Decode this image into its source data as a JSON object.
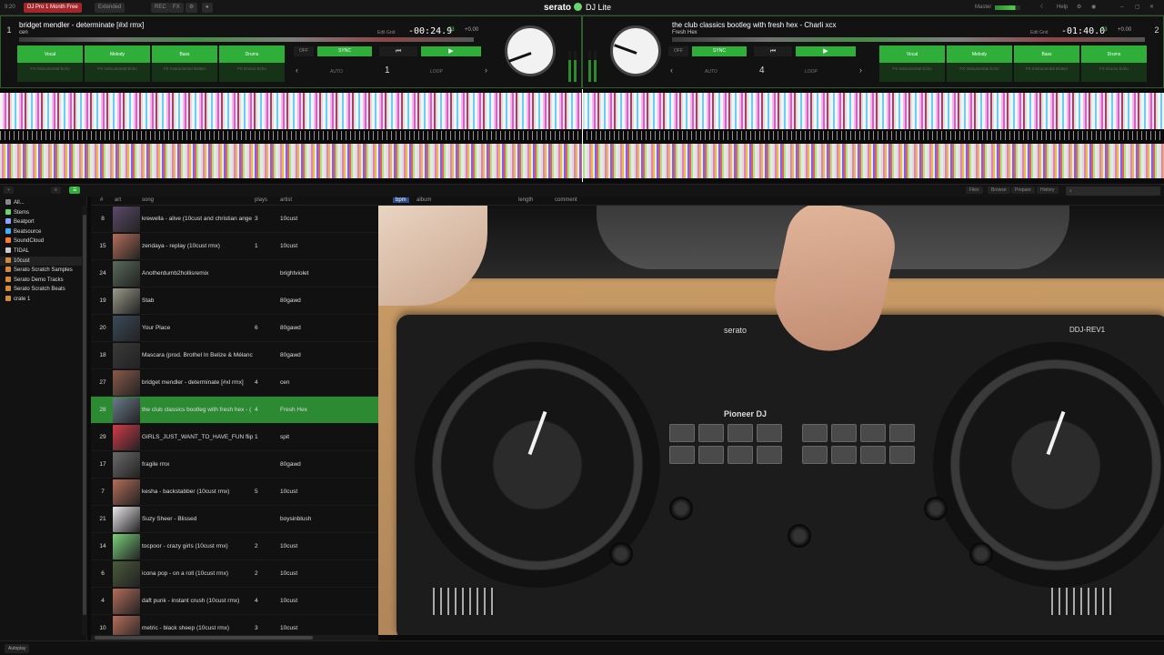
{
  "app": {
    "clock": "9:20",
    "promo": "DJ Pro 1 Month Free",
    "extended": "Extended",
    "rec": "REC",
    "fx": "FX",
    "logo": "serato",
    "logo_sub": "DJ Lite",
    "master": "Master",
    "help": "Help"
  },
  "deck1": {
    "number": "1",
    "title": "bridget mendler - determinate [#xl rmx]",
    "artist": "cen",
    "edit_grid": "Edit Grid",
    "time": "-00:24.9",
    "bpm": "73",
    "pitch": "+0.00",
    "stems": [
      {
        "label": "Vocal",
        "sub": "FX\nInstrumental\nEcho"
      },
      {
        "label": "Melody",
        "sub": "FX\nInstrumental\nEcho"
      },
      {
        "label": "Bass",
        "sub": "FX\nInstrumental\nBraker"
      },
      {
        "label": "Drums",
        "sub": "FX\nDrums\nEcho"
      }
    ],
    "sync_off": "OFF",
    "sync": "SYNC",
    "auto": "AUTO",
    "loop_value": "1",
    "loop": "LOOP"
  },
  "deck2": {
    "number": "2",
    "title": "the club classics bootleg with fresh hex - Charli xcx",
    "artist": "Fresh Hex",
    "edit_grid": "Edit Grid",
    "time": "-01:40.0",
    "bpm": "73",
    "pitch": "+0.00",
    "stems": [
      {
        "label": "Vocal",
        "sub": "FX\nInstrumental\nEcho"
      },
      {
        "label": "Melody",
        "sub": "FX\nInstrumental\nEcho"
      },
      {
        "label": "Bass",
        "sub": "FX\nInstrumental\nBraker"
      },
      {
        "label": "Drums",
        "sub": "FX\nDrums\nEcho"
      }
    ],
    "sync_off": "OFF",
    "sync": "SYNC",
    "auto": "AUTO",
    "loop_value": "4",
    "loop": "LOOP"
  },
  "library_bar": {
    "files": "Files",
    "browse": "Browse",
    "prepare": "Prepare",
    "history": "History",
    "search_placeholder": ""
  },
  "sidebar": {
    "items": [
      {
        "label": "All...",
        "color": "#888888"
      },
      {
        "label": "Stems",
        "color": "#6dd36d"
      },
      {
        "label": "Beatport",
        "color": "#8aa4ff"
      },
      {
        "label": "Beatsource",
        "color": "#39b3ff"
      },
      {
        "label": "SoundCloud",
        "color": "#ff7a2b"
      },
      {
        "label": "TIDAL",
        "color": "#cccccc"
      },
      {
        "label": "10cust",
        "color": "#d48a3a"
      },
      {
        "label": "Serato Scratch Samples",
        "color": "#d48a3a"
      },
      {
        "label": "Serato Demo Tracks",
        "color": "#d48a3a"
      },
      {
        "label": "Serato Scratch Beats",
        "color": "#d48a3a"
      },
      {
        "label": "crate 1",
        "color": "#d48a3a"
      }
    ]
  },
  "columns": {
    "num": "#",
    "art": "art",
    "song": "song",
    "plays": "plays",
    "artist": "artist",
    "bpm": "bpm",
    "album": "album",
    "length": "length",
    "comment": "comment"
  },
  "tracks": [
    {
      "num": "8",
      "song": "krewella - alive (10cust and christian ange",
      "plays": "3",
      "artist": "10cust",
      "art": "#5c4a6a"
    },
    {
      "num": "15",
      "song": "zendaya - replay (10cust rmx)",
      "plays": "1",
      "artist": "10cust",
      "art": "#b46d5a"
    },
    {
      "num": "24",
      "song": "Anotherdumb2hollisremix",
      "plays": "",
      "artist": "brightviolet",
      "art": "#5a6a5a"
    },
    {
      "num": "19",
      "song": "Stab",
      "plays": "",
      "artist": "80gawd",
      "art": "#9a9a8a"
    },
    {
      "num": "20",
      "song": "Your Place",
      "plays": "6",
      "artist": "80gawd",
      "art": "#3a4a5a"
    },
    {
      "num": "18",
      "song": "Mascara (prod. Brothel In Belize & Mélanc",
      "plays": "",
      "artist": "80gawd",
      "art": "#3a3a3a"
    },
    {
      "num": "27",
      "song": "bridget mendler - determinate [#xl rmx]",
      "plays": "4",
      "artist": "cen",
      "art": "#8a5a4a"
    },
    {
      "num": "28",
      "song": "the club classics bootleg with fresh hex - ( ",
      "plays": "4",
      "artist": "Fresh Hex",
      "art": "#6a7a8a",
      "selected": true
    },
    {
      "num": "29",
      "song": "GIRLS_JUST_WANT_TO_HAVE_FUN flip",
      "plays": "1",
      "artist": "spit",
      "art": "#d23a4a"
    },
    {
      "num": "17",
      "song": "fragile rmx",
      "plays": "",
      "artist": "80gawd",
      "art": "#6a6a6a"
    },
    {
      "num": "7",
      "song": "kesha - backstabber (10cust rmx)",
      "plays": "5",
      "artist": "10cust",
      "art": "#b46d5a"
    },
    {
      "num": "21",
      "song": "Suzy Sheer - Blissed",
      "plays": "",
      "artist": "boysinblush",
      "art": "#e9e6ea"
    },
    {
      "num": "14",
      "song": "tocpoor - crazy girls (10cust rmx)",
      "plays": "2",
      "artist": "10cust",
      "art": "#7ad07a"
    },
    {
      "num": "6",
      "song": "icona pop - on a roll (10cust rmx)",
      "plays": "2",
      "artist": "10cust",
      "art": "#4a5a3a"
    },
    {
      "num": "4",
      "song": "daft punk - instant crush (10cust rmx)",
      "plays": "4",
      "artist": "10cust",
      "art": "#b46d5a"
    },
    {
      "num": "10",
      "song": "metric - black sheep (10cust rmx)",
      "plays": "3",
      "artist": "10cust",
      "art": "#b46d5a"
    }
  ],
  "controller": {
    "brand": "Pioneer DJ",
    "model": "DDJ-REV1",
    "software": "serato"
  },
  "footer": {
    "autoplay": "Autoplay"
  }
}
